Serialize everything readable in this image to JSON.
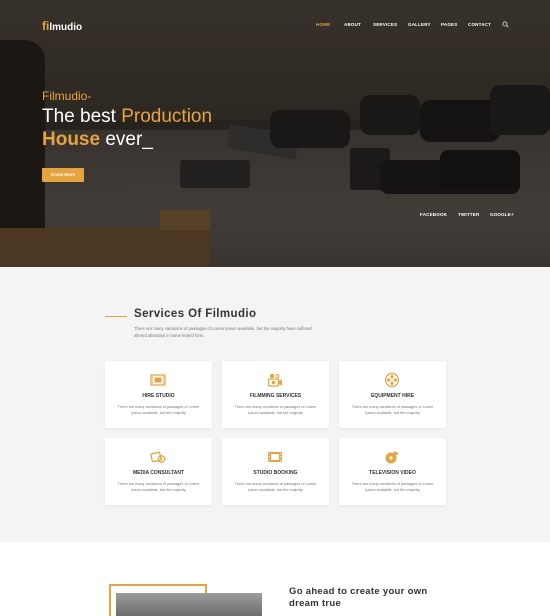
{
  "header": {
    "logo_initial": "fi",
    "logo_rest": "lmudio",
    "nav": [
      "HOME",
      "ABOUT",
      "SERVICES",
      "GALLERY",
      "PAGES",
      "CONTACT"
    ],
    "active_nav": "HOME",
    "search_icon": "search-icon"
  },
  "hero": {
    "subtitle": "Filmudio-",
    "title_part1": "The best ",
    "title_highlight1": "Production",
    "title_highlight2": "House",
    "title_part2": " ever_",
    "button_label": "Know More",
    "social": [
      "FACEBOOK",
      "TWITTER",
      "GOOGLE+"
    ]
  },
  "services": {
    "title": "Services Of Filmudio",
    "description": "There are many variations of passages of Lorem Ipsum available, but the majority have suffered altered alteration in some ledrrid form.",
    "cards": [
      {
        "title": "HIRE STUDIO",
        "icon": "film-icon",
        "desc": "There are many variations of passages of Lorem Ipsum available, but the majority"
      },
      {
        "title": "FILMMING SERVICES",
        "icon": "camera-crew-icon",
        "desc": "There are many variations of passages of Lorem Ipsum available, but the majority"
      },
      {
        "title": "EQUIPMENT HIRE",
        "icon": "film-reel-icon",
        "desc": "There are many variations of passages of Lorem Ipsum available, but the majority"
      },
      {
        "title": "MEDIA CONSULTANT",
        "icon": "tickets-icon",
        "desc": "There are many variations of passages of Lorem Ipsum available, but the majority"
      },
      {
        "title": "STUDIO BOOKING",
        "icon": "film-strip-icon",
        "desc": "There are many variations of passages of Lorem Ipsum available, but the majority"
      },
      {
        "title": "TELEVISION VIDEO",
        "icon": "video-disc-icon",
        "desc": "There are many variations of passages of Lorem Ipsum available, but the majority"
      }
    ]
  },
  "about": {
    "title": "Go ahead to create your own dream true"
  },
  "colors": {
    "accent": "#e7a33e",
    "dark_text": "#333333"
  }
}
